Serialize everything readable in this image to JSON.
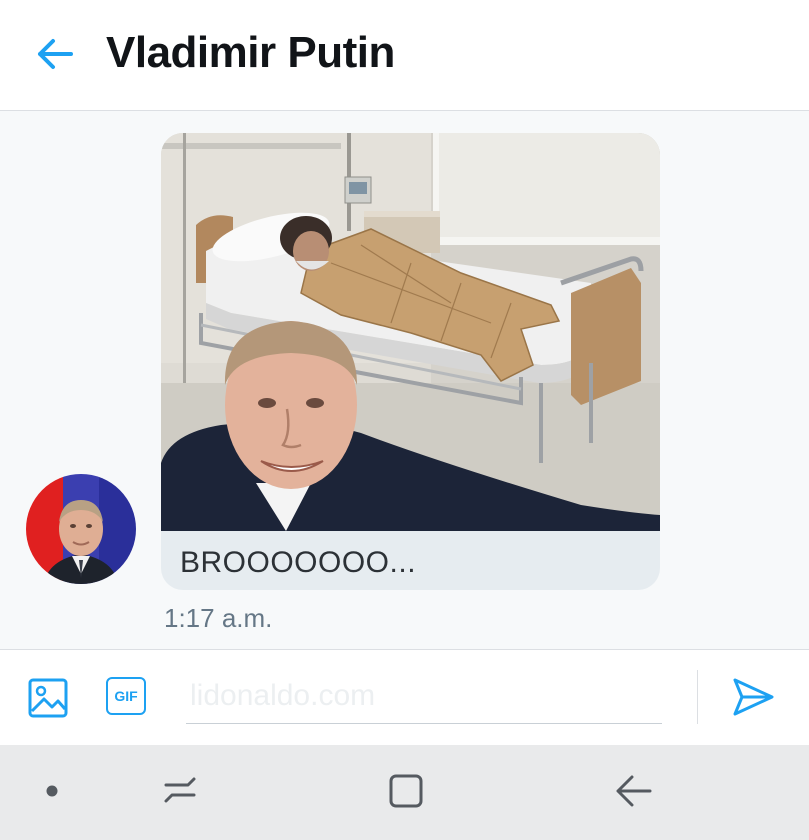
{
  "header": {
    "title": "Vladimir Putin",
    "back_icon": "arrow-left-icon",
    "accent_color": "#1da1f2"
  },
  "message": {
    "caption": "BROOOOOOO...",
    "timestamp": "1:17 a.m.",
    "bubble_color": "#e6ecf0"
  },
  "composer": {
    "placeholder": "lidonaldo.com",
    "image_icon": "image-icon",
    "gif_label": "GIF",
    "send_icon": "send-icon"
  },
  "navbar": {
    "items": [
      "dot-icon",
      "recent-apps-icon",
      "home-square-icon",
      "back-arrow-icon"
    ],
    "background": "#e9eaeb"
  }
}
